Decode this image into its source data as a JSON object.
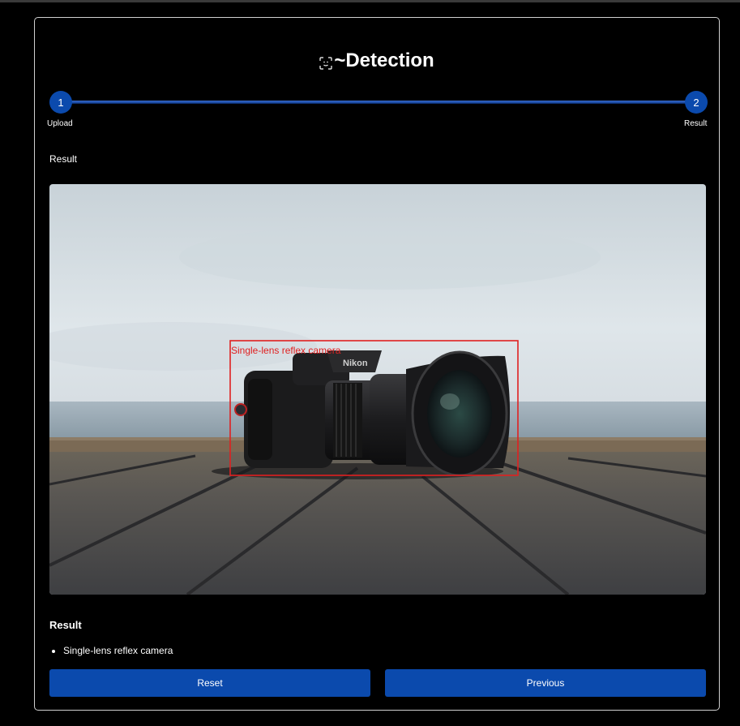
{
  "app": {
    "title": "~Detection",
    "title_icon": "face-scan-icon"
  },
  "stepper": {
    "steps": [
      {
        "number": "1",
        "label": "Upload"
      },
      {
        "number": "2",
        "label": "Result"
      }
    ],
    "accent_color": "#0b4aad"
  },
  "main": {
    "section_label": "Result",
    "image": {
      "description_icon": "camera-photo",
      "detection": {
        "label": "Single-lens reflex camera",
        "box_color": "#e02020"
      }
    },
    "result_heading": "Result",
    "results": [
      "Single-lens reflex camera"
    ]
  },
  "buttons": {
    "reset_label": "Reset",
    "previous_label": "Previous"
  }
}
